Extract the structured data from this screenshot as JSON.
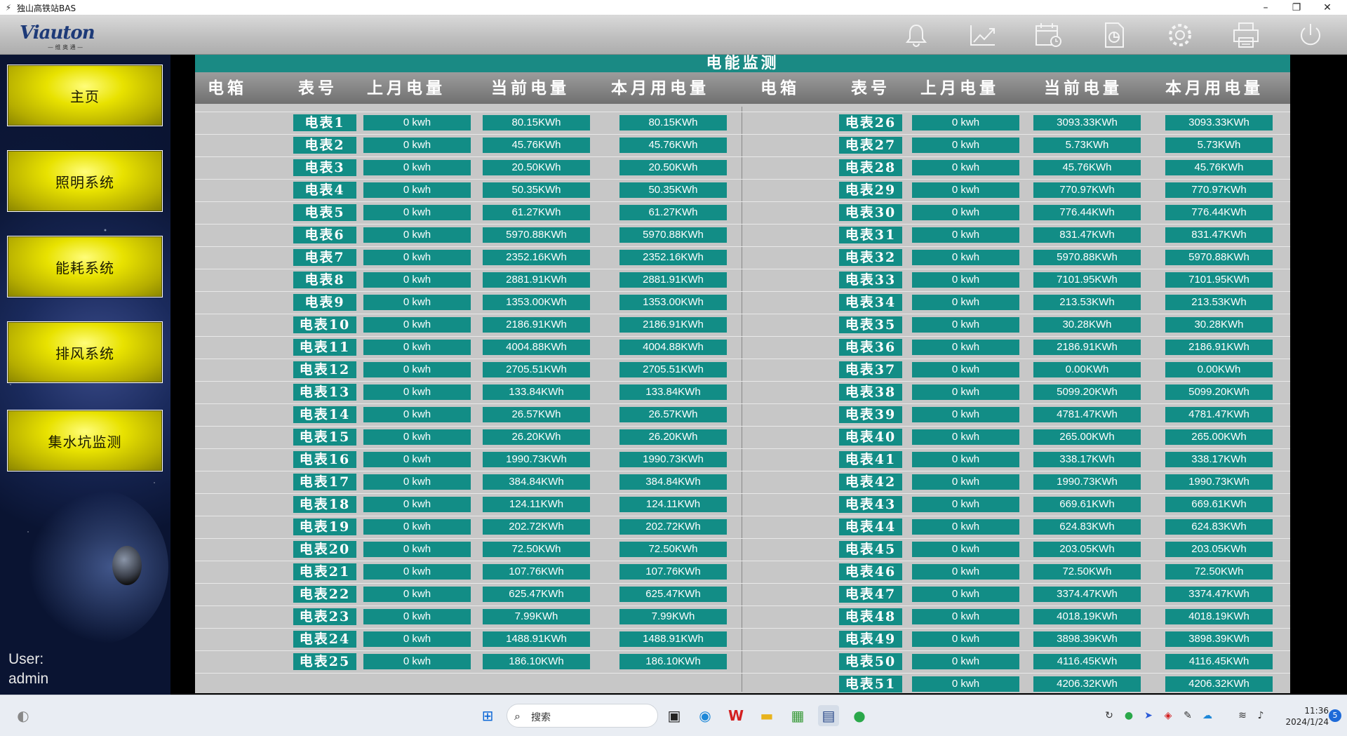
{
  "window": {
    "title": "独山高铁站BAS",
    "min": "–",
    "restore": "❐",
    "close": "✕"
  },
  "logo": {
    "text": "Viauton",
    "sub": "— 维 奥 通 —"
  },
  "nav": [
    {
      "label": "主页"
    },
    {
      "label": "照明系统"
    },
    {
      "label": "能耗系统"
    },
    {
      "label": "排风系统"
    },
    {
      "label": "集水坑监测"
    }
  ],
  "user": {
    "label": "User:",
    "name": "admin"
  },
  "panel": {
    "title": "电能监测",
    "headers": [
      "电箱",
      "表号",
      "上月电量",
      "当前电量",
      "本月用电量",
      "电箱",
      "表号",
      "上月电量",
      "当前电量",
      "本月用电量"
    ]
  },
  "left_rows": [
    {
      "meter": "电表1",
      "last": "0 kwh",
      "current": "80.15KWh",
      "month": "80.15KWh"
    },
    {
      "meter": "电表2",
      "last": "0 kwh",
      "current": "45.76KWh",
      "month": "45.76KWh"
    },
    {
      "meter": "电表3",
      "last": "0 kwh",
      "current": "20.50KWh",
      "month": "20.50KWh"
    },
    {
      "meter": "电表4",
      "last": "0 kwh",
      "current": "50.35KWh",
      "month": "50.35KWh"
    },
    {
      "meter": "电表5",
      "last": "0 kwh",
      "current": "61.27KWh",
      "month": "61.27KWh"
    },
    {
      "meter": "电表6",
      "last": "0 kwh",
      "current": "5970.88KWh",
      "month": "5970.88KWh"
    },
    {
      "meter": "电表7",
      "last": "0 kwh",
      "current": "2352.16KWh",
      "month": "2352.16KWh"
    },
    {
      "meter": "电表8",
      "last": "0 kwh",
      "current": "2881.91KWh",
      "month": "2881.91KWh"
    },
    {
      "meter": "电表9",
      "last": "0 kwh",
      "current": "1353.00KWh",
      "month": "1353.00KWh"
    },
    {
      "meter": "电表10",
      "last": "0 kwh",
      "current": "2186.91KWh",
      "month": "2186.91KWh"
    },
    {
      "meter": "电表11",
      "last": "0 kwh",
      "current": "4004.88KWh",
      "month": "4004.88KWh"
    },
    {
      "meter": "电表12",
      "last": "0 kwh",
      "current": "2705.51KWh",
      "month": "2705.51KWh"
    },
    {
      "meter": "电表13",
      "last": "0 kwh",
      "current": "133.84KWh",
      "month": "133.84KWh"
    },
    {
      "meter": "电表14",
      "last": "0 kwh",
      "current": "26.57KWh",
      "month": "26.57KWh"
    },
    {
      "meter": "电表15",
      "last": "0 kwh",
      "current": "26.20KWh",
      "month": "26.20KWh"
    },
    {
      "meter": "电表16",
      "last": "0 kwh",
      "current": "1990.73KWh",
      "month": "1990.73KWh"
    },
    {
      "meter": "电表17",
      "last": "0 kwh",
      "current": "384.84KWh",
      "month": "384.84KWh"
    },
    {
      "meter": "电表18",
      "last": "0 kwh",
      "current": "124.11KWh",
      "month": "124.11KWh"
    },
    {
      "meter": "电表19",
      "last": "0 kwh",
      "current": "202.72KWh",
      "month": "202.72KWh"
    },
    {
      "meter": "电表20",
      "last": "0 kwh",
      "current": "72.50KWh",
      "month": "72.50KWh"
    },
    {
      "meter": "电表21",
      "last": "0 kwh",
      "current": "107.76KWh",
      "month": "107.76KWh"
    },
    {
      "meter": "电表22",
      "last": "0 kwh",
      "current": "625.47KWh",
      "month": "625.47KWh"
    },
    {
      "meter": "电表23",
      "last": "0 kwh",
      "current": "7.99KWh",
      "month": "7.99KWh"
    },
    {
      "meter": "电表24",
      "last": "0 kwh",
      "current": "1488.91KWh",
      "month": "1488.91KWh"
    },
    {
      "meter": "电表25",
      "last": "0 kwh",
      "current": "186.10KWh",
      "month": "186.10KWh"
    }
  ],
  "right_rows": [
    {
      "meter": "电表26",
      "last": "0 kwh",
      "current": "3093.33KWh",
      "month": "3093.33KWh"
    },
    {
      "meter": "电表27",
      "last": "0 kwh",
      "current": "5.73KWh",
      "month": "5.73KWh"
    },
    {
      "meter": "电表28",
      "last": "0 kwh",
      "current": "45.76KWh",
      "month": "45.76KWh"
    },
    {
      "meter": "电表29",
      "last": "0 kwh",
      "current": "770.97KWh",
      "month": "770.97KWh"
    },
    {
      "meter": "电表30",
      "last": "0 kwh",
      "current": "776.44KWh",
      "month": "776.44KWh"
    },
    {
      "meter": "电表31",
      "last": "0 kwh",
      "current": "831.47KWh",
      "month": "831.47KWh"
    },
    {
      "meter": "电表32",
      "last": "0 kwh",
      "current": "5970.88KWh",
      "month": "5970.88KWh"
    },
    {
      "meter": "电表33",
      "last": "0 kwh",
      "current": "7101.95KWh",
      "month": "7101.95KWh"
    },
    {
      "meter": "电表34",
      "last": "0 kwh",
      "current": "213.53KWh",
      "month": "213.53KWh"
    },
    {
      "meter": "电表35",
      "last": "0 kwh",
      "current": "30.28KWh",
      "month": "30.28KWh"
    },
    {
      "meter": "电表36",
      "last": "0 kwh",
      "current": "2186.91KWh",
      "month": "2186.91KWh"
    },
    {
      "meter": "电表37",
      "last": "0 kwh",
      "current": "0.00KWh",
      "month": "0.00KWh"
    },
    {
      "meter": "电表38",
      "last": "0 kwh",
      "current": "5099.20KWh",
      "month": "5099.20KWh"
    },
    {
      "meter": "电表39",
      "last": "0 kwh",
      "current": "4781.47KWh",
      "month": "4781.47KWh"
    },
    {
      "meter": "电表40",
      "last": "0 kwh",
      "current": "265.00KWh",
      "month": "265.00KWh"
    },
    {
      "meter": "电表41",
      "last": "0 kwh",
      "current": "338.17KWh",
      "month": "338.17KWh"
    },
    {
      "meter": "电表42",
      "last": "0 kwh",
      "current": "1990.73KWh",
      "month": "1990.73KWh"
    },
    {
      "meter": "电表43",
      "last": "0 kwh",
      "current": "669.61KWh",
      "month": "669.61KWh"
    },
    {
      "meter": "电表44",
      "last": "0 kwh",
      "current": "624.83KWh",
      "month": "624.83KWh"
    },
    {
      "meter": "电表45",
      "last": "0 kwh",
      "current": "203.05KWh",
      "month": "203.05KWh"
    },
    {
      "meter": "电表46",
      "last": "0 kwh",
      "current": "72.50KWh",
      "month": "72.50KWh"
    },
    {
      "meter": "电表47",
      "last": "0 kwh",
      "current": "3374.47KWh",
      "month": "3374.47KWh"
    },
    {
      "meter": "电表48",
      "last": "0 kwh",
      "current": "4018.19KWh",
      "month": "4018.19KWh"
    },
    {
      "meter": "电表49",
      "last": "0 kwh",
      "current": "3898.39KWh",
      "month": "3898.39KWh"
    },
    {
      "meter": "电表50",
      "last": "0 kwh",
      "current": "4116.45KWh",
      "month": "4116.45KWh"
    },
    {
      "meter": "电表51",
      "last": "0 kwh",
      "current": "4206.32KWh",
      "month": "4206.32KWh"
    }
  ],
  "header_icons": [
    "bell-icon",
    "trend-chart-icon",
    "calendar-clock-icon",
    "report-document-icon",
    "settings-gear-icon",
    "printer-icon",
    "power-icon"
  ],
  "taskbar": {
    "search_placeholder": "搜索",
    "time": "11:36",
    "date": "2024/1/24",
    "badge": "5"
  },
  "colors": {
    "teal": "#128d86",
    "panel_bg": "#c7c7c7",
    "nav_yellow": "#e8e200"
  }
}
